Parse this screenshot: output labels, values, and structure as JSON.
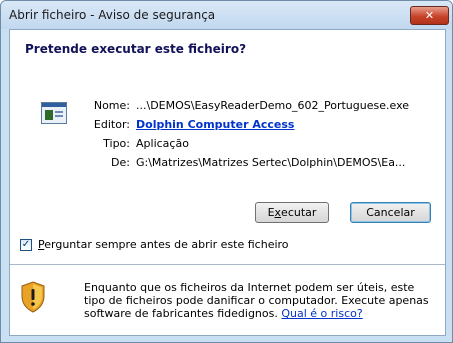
{
  "window": {
    "title": "Abrir ficheiro - Aviso de segurança",
    "close_glyph": "✕"
  },
  "dialog": {
    "heading": "Pretende executar este ficheiro?",
    "icon": "application-file-icon",
    "fields": [
      {
        "key": "Nome:",
        "value": "...\\DEMOS\\EasyReaderDemo_602_Portuguese.exe"
      },
      {
        "key": "Editor:",
        "value": "Dolphin Computer Access"
      },
      {
        "key": "Tipo:",
        "value": "Aplicação"
      },
      {
        "key": "De:",
        "value": "G:\\Matrizes\\Matrizes Sertec\\Dolphin\\DEMOS\\Ea..."
      }
    ],
    "buttons": {
      "run_prefix": "E",
      "run_underlined": "x",
      "run_suffix": "ecutar",
      "cancel": "Cancelar"
    },
    "checkbox": {
      "checked": true,
      "mark": "✓",
      "label_underlined": "P",
      "label_rest": "erguntar sempre antes de abrir este ficheiro"
    },
    "warning": {
      "icon": "security-shield-icon",
      "text": "Enquanto que os ficheiros da Internet podem ser úteis, este tipo de ficheiros pode danificar o computador. Execute apenas software de fabricantes fidedignos.",
      "link": "Qual é o risco?"
    }
  },
  "colors": {
    "frame": "#c9dff2",
    "link": "#0033cc",
    "close_red": "#c7442b"
  }
}
